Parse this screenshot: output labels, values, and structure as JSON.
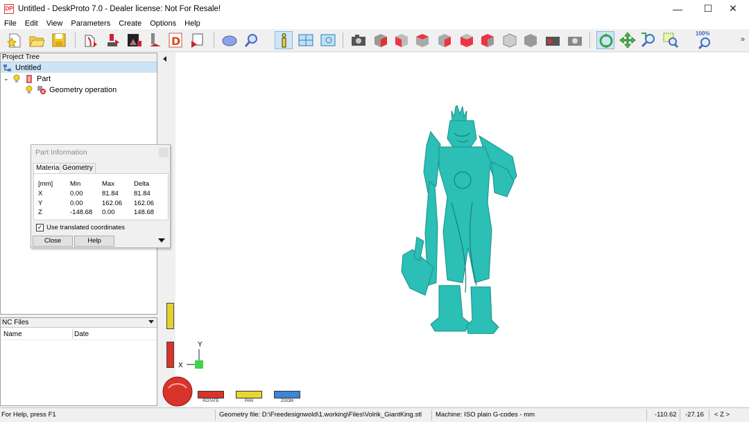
{
  "window": {
    "title": "Untitled - DeskProto 7.0 - Dealer license: Not For Resale!",
    "minimize": "—",
    "maximize": "☐",
    "close": "✕",
    "logo_text": "DP"
  },
  "menu": [
    "File",
    "Edit",
    "View",
    "Parameters",
    "Create",
    "Options",
    "Help"
  ],
  "toolbar": {
    "zoom_label": "100%",
    "overflow": "»",
    "buttons": [
      "new-file-icon",
      "open-folder-icon",
      "save-icon",
      "import-geometry-icon",
      "move-part-icon",
      "image-import-icon",
      "drill-icon",
      "2d-vector-icon",
      "export-icon",
      "shape-view-icon",
      "search-view-icon",
      "info-icon",
      "tile-view-icon",
      "nc-view-icon",
      "camera-icon",
      "view-cube-icon",
      "view-front-icon",
      "view-back-icon",
      "view-left-icon",
      "view-right-icon",
      "view-top-icon",
      "view-bottom-icon",
      "view-iso-icon",
      "view-grey-icon",
      "camera-red-icon",
      "camera-grey-icon",
      "rotate-icon",
      "pan-icon",
      "zoom-in-icon",
      "zoom-window-icon",
      "zoom-100-icon"
    ],
    "active_color": "#cde6f7"
  },
  "project_tree": {
    "header": "Project Tree",
    "root": "Untitled",
    "part": "Part",
    "operation": "Geometry operation"
  },
  "nc_files": {
    "header": "NC Files",
    "columns": [
      "Name",
      "Date"
    ]
  },
  "viewport": {
    "model_color": "#2bbfb6",
    "axis_x": "X",
    "axis_y": "Y",
    "controls": [
      {
        "label": "ROTATE",
        "color": "#d8342b"
      },
      {
        "label": "PAN",
        "color": "#e9d62e"
      },
      {
        "label": "ZOOM",
        "color": "#3a86d6"
      }
    ]
  },
  "dialog": {
    "title": "Part Information",
    "tabs": [
      "Material",
      "Geometry"
    ],
    "headers": [
      "[mm]",
      "Min",
      "Max",
      "Delta"
    ],
    "rows": [
      [
        "X",
        "0.00",
        "81.84",
        "81.84"
      ],
      [
        "Y",
        "0.00",
        "162.06",
        "162.06"
      ],
      [
        "Z",
        "-148.68",
        "0.00",
        "148.68"
      ]
    ],
    "checkbox_label": "Use translated coordinates",
    "checkbox_checked": true,
    "checkmark": "✓",
    "close_button": "Close",
    "help_button": "Help"
  },
  "status": {
    "help": "For Help, press F1",
    "geometry_file": "Geometry file: D:\\Freedesignwold\\1.working\\Files\\Volrik_GiantKing.stl",
    "machine": "Machine: ISO plain G-codes - mm",
    "coord_x": "-110.62",
    "coord_y": "-27.16",
    "axis_indicator": "< Z >"
  }
}
